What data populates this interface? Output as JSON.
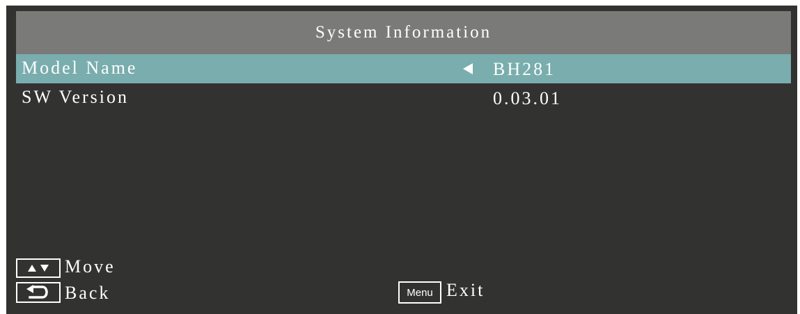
{
  "header": {
    "title": "System Information"
  },
  "rows": [
    {
      "label": "Model Name",
      "value": "BH281",
      "selected": true
    },
    {
      "label": "SW Version",
      "value": "0.03.01",
      "selected": false
    }
  ],
  "footer": {
    "move_label": "Move",
    "back_label": "Back",
    "menu_key_label": "Menu",
    "exit_label": "Exit"
  },
  "colors": {
    "background": "#323331",
    "title_bar": "#7a7a78",
    "selected_row": "#79adae",
    "text": "#ffffff"
  },
  "icons": {
    "up_down": "up-down-arrows-icon",
    "back": "return-arrow-icon",
    "selector": "left-triangle-icon"
  }
}
